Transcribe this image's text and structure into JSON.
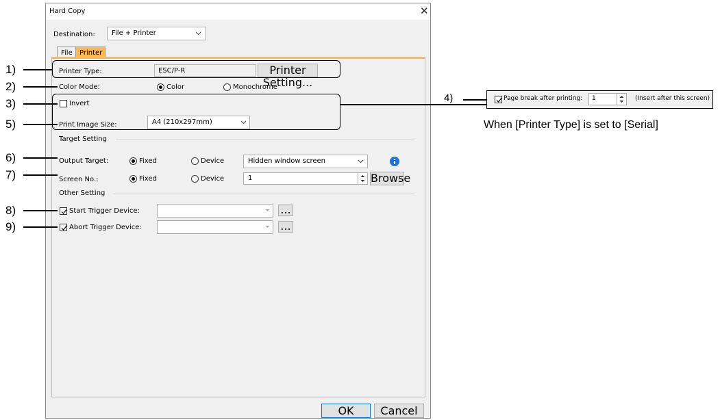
{
  "dialog": {
    "title": "Hard Copy",
    "destination_label": "Destination:",
    "destination_value": "File + Printer",
    "tabs": [
      {
        "label": "File"
      },
      {
        "label": "Printer"
      }
    ],
    "printer_type_label": "Printer Type:",
    "printer_type_value": "ESC/P-R",
    "printer_setting_button": "Printer Setting...",
    "color_mode_label": "Color Mode:",
    "color_option": "Color",
    "monochrome_option": "Monochrome",
    "invert_label": "Invert",
    "print_image_size_label": "Print Image Size:",
    "print_image_size_value": "A4 (210x297mm)",
    "target_setting_label": "Target Setting",
    "output_target_label": "Output Target:",
    "output_fixed": "Fixed",
    "output_device": "Device",
    "output_target_value": "Hidden window screen",
    "screen_no_label": "Screen No.:",
    "screen_fixed": "Fixed",
    "screen_device": "Device",
    "screen_no_value": "1",
    "browse_button": "Browse",
    "other_setting_label": "Other Setting",
    "start_trigger_label": "Start Trigger Device:",
    "abort_trigger_label": "Abort Trigger Device:",
    "ellipsis": "...",
    "ok_button": "OK",
    "cancel_button": "Cancel"
  },
  "side_panel": {
    "page_break_label": "Page break after printing:",
    "page_break_value": "1",
    "page_break_note": "(Insert after this screen)",
    "caption": "When [Printer Type] is set to [Serial]"
  },
  "callouts": {
    "c1": "1)",
    "c2": "2)",
    "c3": "3)",
    "c4": "4)",
    "c5": "5)",
    "c6": "6)",
    "c7": "7)",
    "c8": "8)",
    "c9": "9)"
  },
  "colors": {
    "tab_accent": "#ffb84d",
    "info_icon": "#1a73d8"
  }
}
